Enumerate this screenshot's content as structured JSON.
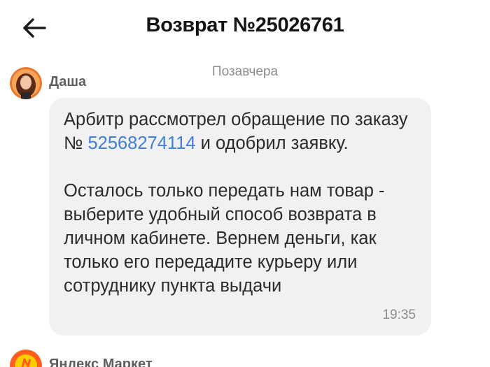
{
  "header": {
    "back_icon": "arrow-left-icon",
    "title": "Возврат №25026761"
  },
  "chat": {
    "date_separator": "Позавчера",
    "messages": [
      {
        "sender": "Даша",
        "avatar": "user-photo-avatar",
        "text_before_link": "Арбитр рассмотрел обращение по заказу № ",
        "order_link": "52568274114",
        "text_after_link": " и одобрил заявку.",
        "paragraph2": "Осталось только передать нам товар - выберите удобный способ возврата в личном кабинете. Вернем деньги, как только его передадите курьеру или сотруднику пункта выдачи",
        "time": "19:35"
      }
    ],
    "next_sender": {
      "name": "Яндекс Маркет",
      "avatar": "yandex-market-logo"
    }
  },
  "colors": {
    "link": "#3f7fd6",
    "bubble": "#f1f1f3",
    "muted_text": "#8d8d8d",
    "market_brand": "#ff5c1f"
  }
}
